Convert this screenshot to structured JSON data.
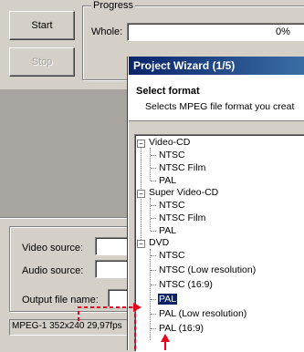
{
  "main": {
    "start_label": "Start",
    "stop_label": "Stop",
    "progress_label": "Progress",
    "whole_label": "Whole:",
    "whole_value": "0%",
    "video_source_label": "Video source:",
    "audio_source_label": "Audio source:",
    "output_file_label": "Output file name:",
    "status_text": "MPEG-1 352x240 29,97fps"
  },
  "wizard": {
    "title": "Project Wizard (1/5)",
    "heading": "Select format",
    "description": "Selects MPEG file format you creat",
    "tree": [
      {
        "label": "Video-CD",
        "level": 0
      },
      {
        "label": "NTSC",
        "level": 1
      },
      {
        "label": "NTSC Film",
        "level": 1
      },
      {
        "label": "PAL",
        "level": 1
      },
      {
        "label": "Super Video-CD",
        "level": 0
      },
      {
        "label": "NTSC",
        "level": 1
      },
      {
        "label": "NTSC Film",
        "level": 1
      },
      {
        "label": "PAL",
        "level": 1
      },
      {
        "label": "DVD",
        "level": 0
      },
      {
        "label": "NTSC",
        "level": 1
      },
      {
        "label": "NTSC (Low resolution)",
        "level": 1
      },
      {
        "label": "NTSC (16:9)",
        "level": 1
      },
      {
        "label": "PAL",
        "level": 1,
        "selected": true
      },
      {
        "label": "PAL (Low resolution)",
        "level": 1
      },
      {
        "label": "PAL (16:9)",
        "level": 1
      }
    ]
  },
  "colors": {
    "annotation_red": "#e8001c",
    "selection": "#0a246a",
    "titlebar": "#0a246a"
  }
}
